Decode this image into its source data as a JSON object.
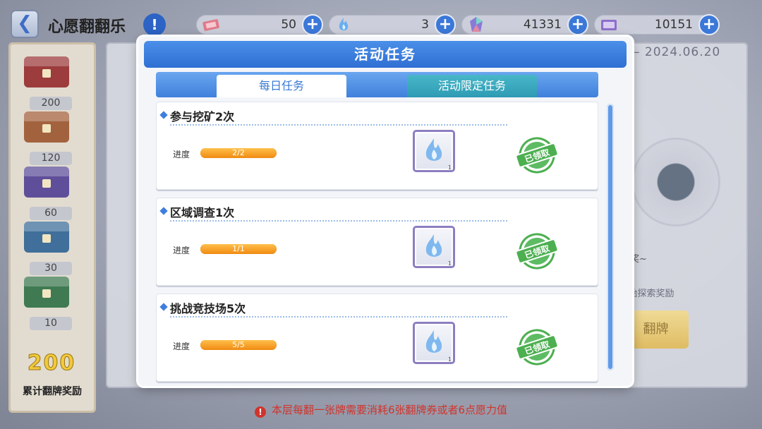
{
  "header": {
    "back_glyph": "❮",
    "title": "心愿翻翻乐",
    "info_glyph": "!"
  },
  "resources": [
    {
      "name": "ticket",
      "value": "50"
    },
    {
      "name": "flame",
      "value": "3"
    },
    {
      "name": "crystal",
      "value": "41331"
    },
    {
      "name": "card",
      "value": "10151"
    }
  ],
  "plus_glyph": "+",
  "background": {
    "date": "– 2024.06.20",
    "explore_label": "始探索奖励",
    "flip_label": "翻牌",
    "partial_text": "奖~",
    "hint_icon": "!",
    "hint": "本层每翻一张牌需要消耗6张翻牌券或者6点愿力值"
  },
  "sidebar": {
    "chests": [
      {
        "count": "200",
        "color": "#9c3c3c"
      },
      {
        "count": "120",
        "color": "#a3623e"
      },
      {
        "count": "60",
        "color": "#5f4f9a"
      },
      {
        "count": "30",
        "color": "#3f6f9a"
      },
      {
        "count": "10",
        "color": "#3f7a52"
      }
    ],
    "total": "200",
    "label": "累计翻牌奖励"
  },
  "modal": {
    "title": "活动任务",
    "tabs": {
      "daily": "每日任务",
      "limited": "活动限定任务"
    },
    "progress_label": "进度",
    "stamp_text": "已领取",
    "tasks": [
      {
        "title": "参与挖矿2次",
        "progress": "2/2",
        "ratio": 1.0,
        "reward_qty": "1"
      },
      {
        "title": "区域调查1次",
        "progress": "1/1",
        "ratio": 1.0,
        "reward_qty": "1"
      },
      {
        "title": "挑战竞技场5次",
        "progress": "5/5",
        "ratio": 1.0,
        "reward_qty": "1"
      }
    ]
  },
  "colors": {
    "accent": "#2f6fd3",
    "stamp": "#4caf50",
    "progress": "#f08a12"
  }
}
